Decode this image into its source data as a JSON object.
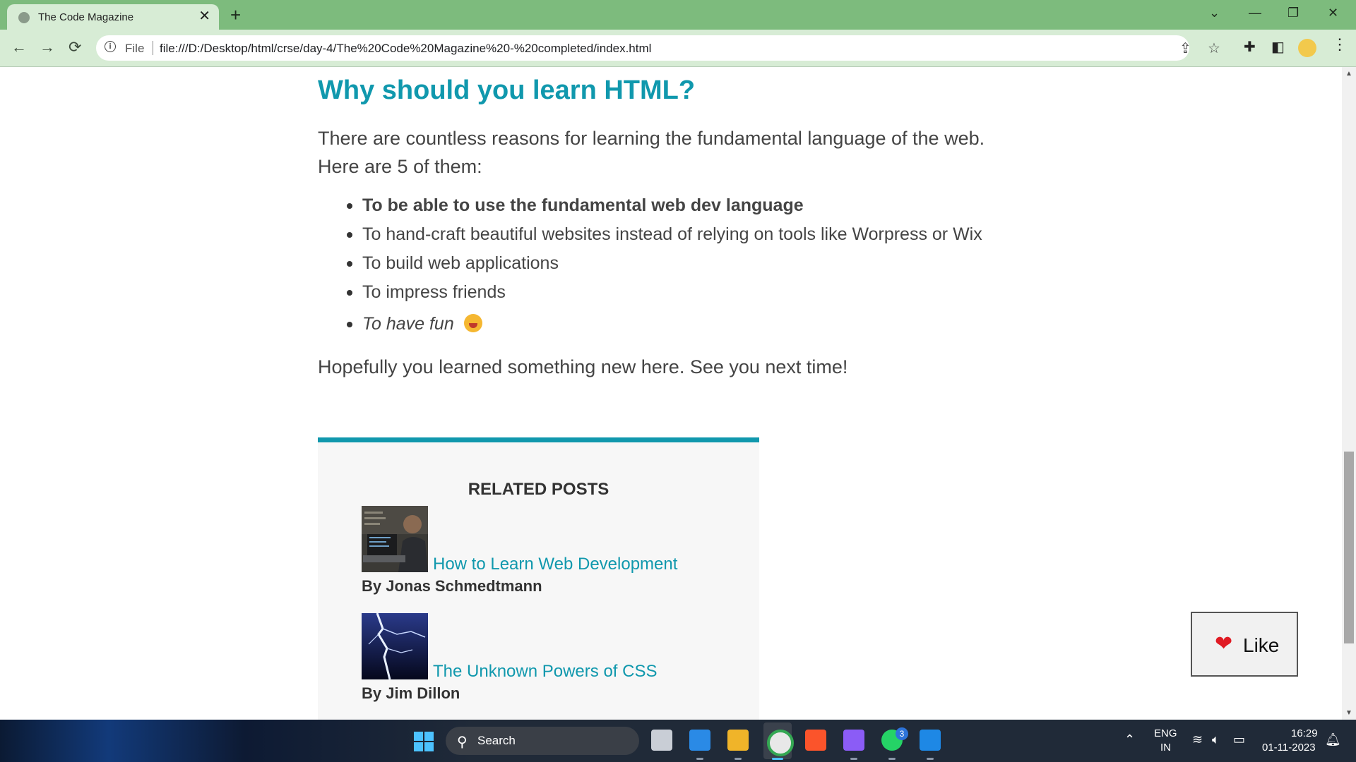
{
  "browser": {
    "tab_title": "The Code Magazine",
    "tab_close": "✕",
    "new_tab": "+",
    "url_scheme": "File",
    "url": "file:///D:/Desktop/html/crse/day-4/The%20Code%20Magazine%20-%20completed/index.html"
  },
  "article": {
    "heading": "Why should you learn HTML?",
    "intro": "There are countless reasons for learning the fundamental language of the web. Here are 5 of them:",
    "reasons": [
      "To be able to use the fundamental web dev language",
      "To hand-craft beautiful websites instead of relying on tools like Worpress or Wix",
      "To build web applications",
      "To impress friends",
      "To have fun"
    ],
    "outro": "Hopefully you learned something new here. See you next time!"
  },
  "related": {
    "title": "RELATED POSTS",
    "posts": [
      {
        "title": "How to Learn Web Development",
        "author": "By Jonas Schmedtmann"
      },
      {
        "title": "The Unknown Powers of CSS",
        "author": "By Jim Dillon"
      }
    ]
  },
  "like_button": {
    "label": "Like"
  },
  "taskbar": {
    "search_placeholder": "Search",
    "whatsapp_badge": "3",
    "lang_top": "ENG",
    "lang_bottom": "IN",
    "time": "16:29",
    "date": "01-11-2023"
  },
  "colors": {
    "accent": "#1098ad",
    "chrome_green": "#7dbb7d",
    "taskbar": "#202a38"
  }
}
